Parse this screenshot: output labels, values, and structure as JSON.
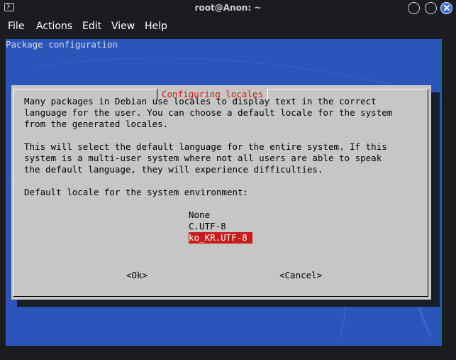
{
  "window": {
    "title": "root@Anon: ~"
  },
  "menu": {
    "items": [
      "File",
      "Actions",
      "Edit",
      "View",
      "Help"
    ]
  },
  "terminal": {
    "header": "Package configuration"
  },
  "dialog": {
    "title": "Configuring locales",
    "paragraph1": [
      "Many packages in Debian use locales to display text in the correct",
      "language for the user. You can choose a default locale for the system",
      "from the generated locales."
    ],
    "paragraph2": [
      "This will select the default language for the entire system. If this",
      "system is a multi-user system where not all users are able to speak",
      "the default language, they will experience difficulties."
    ],
    "prompt": "Default locale for the system environment:",
    "options": [
      "None",
      "C.UTF-8",
      "ko_KR.UTF-8"
    ],
    "selected_option": "ko_KR.UTF-8",
    "ok_label": "<Ok>",
    "cancel_label": "<Cancel>"
  },
  "colors": {
    "terminal_bg": "#2b55b8",
    "dialog_bg": "#c6c6c6",
    "title_red": "#d01818",
    "selection_red": "#c81c1c",
    "close_button_blue": "#3d6fe0"
  }
}
